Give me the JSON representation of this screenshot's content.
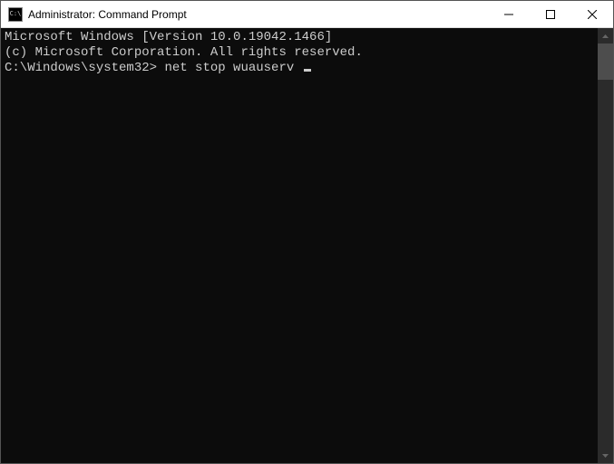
{
  "window": {
    "title": "Administrator: Command Prompt",
    "icon_label": "C:\\"
  },
  "terminal": {
    "header_line1": "Microsoft Windows [Version 10.0.19042.1466]",
    "header_line2": "(c) Microsoft Corporation. All rights reserved.",
    "blank": "",
    "prompt": "C:\\Windows\\system32>",
    "command": "net stop wuauserv"
  }
}
